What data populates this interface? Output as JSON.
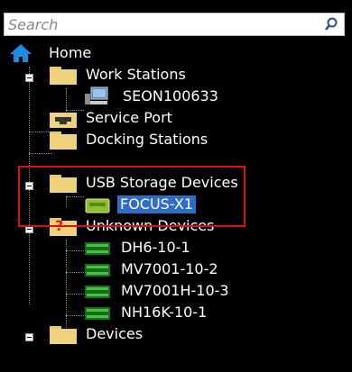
{
  "search": {
    "placeholder": "Search"
  },
  "tree": {
    "home": "Home",
    "work_stations": "Work Stations",
    "seon": "SEON100633",
    "service_port": "Service Port",
    "docking_stations": "Docking Stations",
    "usb_storage": "USB Storage Devices",
    "focus": "FOCUS-X1",
    "unknown_devices": "Unknown Devices",
    "unknown_badge": "?",
    "unknown_children": [
      "DH6-10-1",
      "MV7001-10-2",
      "MV7001H-10-3",
      "NH16K-10-1"
    ],
    "devices": "Devices"
  },
  "colors": {
    "background": "#000000",
    "text": "#ffffff",
    "selection": "#2e6ec9",
    "highlight_border": "#dd1111",
    "folder": "#f1d27c",
    "device_green": "#2ea52e"
  }
}
